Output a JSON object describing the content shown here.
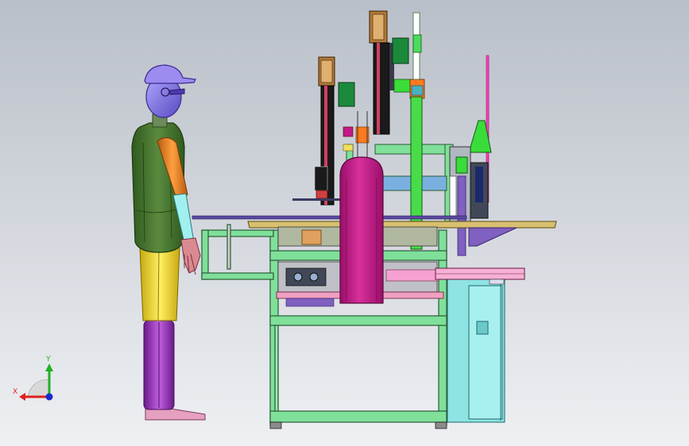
{
  "viewport": {
    "background_top": "#b9bfc8",
    "background_bottom": "#eef0f3"
  },
  "triad": {
    "x_label": "X",
    "y_label": "Y",
    "x_color": "#e02020",
    "y_color": "#22b022",
    "z_color": "#1a2ad0"
  },
  "colors": {
    "frame_green": "#7fe09a",
    "frame_edge": "#2a5a35",
    "magenta_guard": "#c21a87",
    "bright_green": "#49dc49",
    "cyan_cabinet": "#8fe3e3",
    "human_torso": "#3e6e2a",
    "human_arm": "#e07a1a",
    "human_legs_upper": "#e8d02a",
    "human_legs_lower": "#9a2ab8",
    "human_head": "#8a7ae8",
    "pink_mast": "#ff40c0",
    "purple_base": "#8060c0"
  }
}
